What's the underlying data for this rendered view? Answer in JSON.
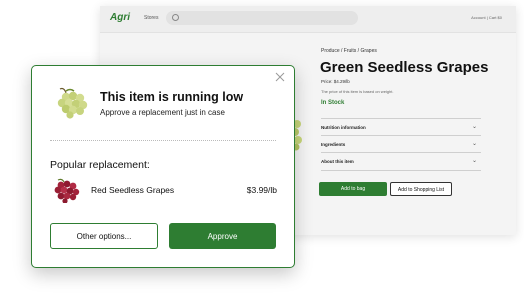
{
  "background_page": {
    "logo": "Agri",
    "nav_link": "Stores",
    "top_right": "Account | Cart $0",
    "breadcrumb": "Produce / Fruits / Grapes",
    "title": "Green Seedless Grapes",
    "price": "Price: $4.29/lb",
    "note": "The price of this item is based on weight.",
    "stock": "In Stock",
    "accordion": [
      "Nutrition information",
      "Ingredients",
      "About this item"
    ],
    "add_to_bag": "Add to bag",
    "add_to_list": "Add to Shopping List",
    "accent": "#2e7d32"
  },
  "modal": {
    "title": "This item is running low",
    "subtitle": "Approve a replacement just in case",
    "popular_label": "Popular replacement:",
    "replacement_name": "Red Seedless Grapes",
    "replacement_price": "$3.99/lb",
    "other_button": "Other options...",
    "approve_button": "Approve",
    "icons": {
      "close": "close-icon",
      "hero": "green-grapes-image",
      "replacement": "red-grapes-image"
    }
  }
}
